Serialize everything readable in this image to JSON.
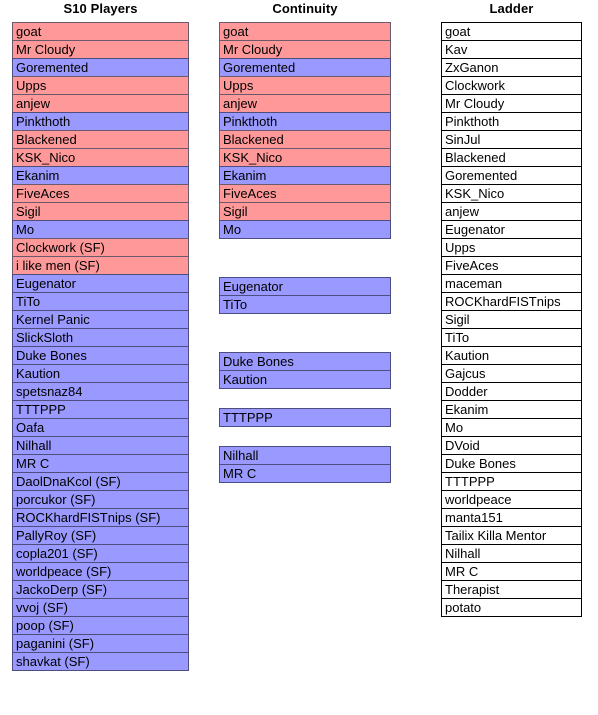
{
  "columns": [
    {
      "id": "s10-players",
      "title": "S10 Players",
      "style": "tinted",
      "rows": [
        {
          "label": "goat",
          "tone": "red"
        },
        {
          "label": "Mr Cloudy",
          "tone": "red"
        },
        {
          "label": "Goremented",
          "tone": "blue"
        },
        {
          "label": "Upps",
          "tone": "red"
        },
        {
          "label": "anjew",
          "tone": "red"
        },
        {
          "label": "Pinkthoth",
          "tone": "blue"
        },
        {
          "label": "Blackened",
          "tone": "red"
        },
        {
          "label": "KSK_Nico",
          "tone": "red"
        },
        {
          "label": "Ekanim",
          "tone": "blue"
        },
        {
          "label": "FiveAces",
          "tone": "red"
        },
        {
          "label": "Sigil",
          "tone": "red"
        },
        {
          "label": "Mo",
          "tone": "blue"
        },
        {
          "label": "Clockwork (SF)",
          "tone": "red"
        },
        {
          "label": "i like men (SF)",
          "tone": "red"
        },
        {
          "label": "Eugenator",
          "tone": "blue"
        },
        {
          "label": "TiTo",
          "tone": "blue"
        },
        {
          "label": "Kernel Panic",
          "tone": "blue"
        },
        {
          "label": "SlickSloth",
          "tone": "blue"
        },
        {
          "label": "Duke Bones",
          "tone": "blue"
        },
        {
          "label": "Kaution",
          "tone": "blue"
        },
        {
          "label": "spetsnaz84",
          "tone": "blue"
        },
        {
          "label": "TTTPPP",
          "tone": "blue"
        },
        {
          "label": "Oafa",
          "tone": "blue"
        },
        {
          "label": "Nilhall",
          "tone": "blue"
        },
        {
          "label": "MR C",
          "tone": "blue"
        },
        {
          "label": "DaolDnaKcol (SF)",
          "tone": "blue"
        },
        {
          "label": "porcukor (SF)",
          "tone": "blue"
        },
        {
          "label": "ROCKhardFISTnips (SF)",
          "tone": "blue"
        },
        {
          "label": "PallyRoy (SF)",
          "tone": "blue"
        },
        {
          "label": "copla201 (SF)",
          "tone": "blue"
        },
        {
          "label": "worldpeace (SF)",
          "tone": "blue"
        },
        {
          "label": "JackoDerp (SF)",
          "tone": "blue"
        },
        {
          "label": "vvoj (SF)",
          "tone": "blue"
        },
        {
          "label": "poop (SF)",
          "tone": "blue"
        },
        {
          "label": "paganini (SF)",
          "tone": "blue"
        },
        {
          "label": "shavkat (SF)",
          "tone": "blue"
        }
      ]
    },
    {
      "id": "continuity",
      "title": "Continuity",
      "style": "tinted",
      "rows": [
        {
          "label": "goat",
          "tone": "red"
        },
        {
          "label": "Mr Cloudy",
          "tone": "red"
        },
        {
          "label": "Goremented",
          "tone": "blue"
        },
        {
          "label": "Upps",
          "tone": "red"
        },
        {
          "label": "anjew",
          "tone": "red"
        },
        {
          "label": "Pinkthoth",
          "tone": "blue"
        },
        {
          "label": "Blackened",
          "tone": "red"
        },
        {
          "label": "KSK_Nico",
          "tone": "red"
        },
        {
          "label": "Ekanim",
          "tone": "blue"
        },
        {
          "label": "FiveAces",
          "tone": "red"
        },
        {
          "label": "Sigil",
          "tone": "red"
        },
        {
          "label": "Mo",
          "tone": "blue"
        },
        {
          "label": "",
          "tone": "empty"
        },
        {
          "label": "",
          "tone": "empty"
        },
        {
          "label": "Eugenator",
          "tone": "blue"
        },
        {
          "label": "TiTo",
          "tone": "blue"
        },
        {
          "label": "",
          "tone": "empty"
        },
        {
          "label": "",
          "tone": "empty"
        },
        {
          "label": "Duke Bones",
          "tone": "blue"
        },
        {
          "label": "Kaution",
          "tone": "blue"
        },
        {
          "label": "",
          "tone": "empty"
        },
        {
          "label": "TTTPPP",
          "tone": "blue"
        },
        {
          "label": "",
          "tone": "empty"
        },
        {
          "label": "Nilhall",
          "tone": "blue"
        },
        {
          "label": "MR C",
          "tone": "blue"
        }
      ]
    },
    {
      "id": "ladder",
      "title": "Ladder",
      "style": "plain",
      "rows": [
        {
          "label": "goat",
          "tone": "plain"
        },
        {
          "label": "Kav",
          "tone": "plain"
        },
        {
          "label": "ZxGanon",
          "tone": "plain"
        },
        {
          "label": "Clockwork",
          "tone": "plain"
        },
        {
          "label": "Mr Cloudy",
          "tone": "plain"
        },
        {
          "label": "Pinkthoth",
          "tone": "plain"
        },
        {
          "label": "SinJul",
          "tone": "plain"
        },
        {
          "label": "Blackened",
          "tone": "plain"
        },
        {
          "label": "Goremented",
          "tone": "plain"
        },
        {
          "label": "KSK_Nico",
          "tone": "plain"
        },
        {
          "label": "anjew",
          "tone": "plain"
        },
        {
          "label": "Eugenator",
          "tone": "plain"
        },
        {
          "label": "Upps",
          "tone": "plain"
        },
        {
          "label": "FiveAces",
          "tone": "plain"
        },
        {
          "label": "maceman",
          "tone": "plain"
        },
        {
          "label": "ROCKhardFISTnips",
          "tone": "plain"
        },
        {
          "label": "Sigil",
          "tone": "plain"
        },
        {
          "label": "TiTo",
          "tone": "plain"
        },
        {
          "label": "Kaution",
          "tone": "plain"
        },
        {
          "label": "Gajcus",
          "tone": "plain"
        },
        {
          "label": "Dodder",
          "tone": "plain"
        },
        {
          "label": "Ekanim",
          "tone": "plain"
        },
        {
          "label": "Mo",
          "tone": "plain"
        },
        {
          "label": "DVoid",
          "tone": "plain"
        },
        {
          "label": "Duke Bones",
          "tone": "plain"
        },
        {
          "label": "TTTPPP",
          "tone": "plain"
        },
        {
          "label": "worldpeace",
          "tone": "plain"
        },
        {
          "label": "manta151",
          "tone": "plain"
        },
        {
          "label": "Tailix Killa Mentor",
          "tone": "plain"
        },
        {
          "label": "Nilhall",
          "tone": "plain"
        },
        {
          "label": "MR C",
          "tone": "plain"
        },
        {
          "label": "Therapist",
          "tone": "plain"
        },
        {
          "label": "potato",
          "tone": "plain"
        }
      ]
    }
  ],
  "palette": {
    "red_cell": "#ff9999",
    "blue_cell": "#9999ff",
    "plain_cell": "#ffffff",
    "text": "#000000",
    "background": "#ffffff"
  }
}
